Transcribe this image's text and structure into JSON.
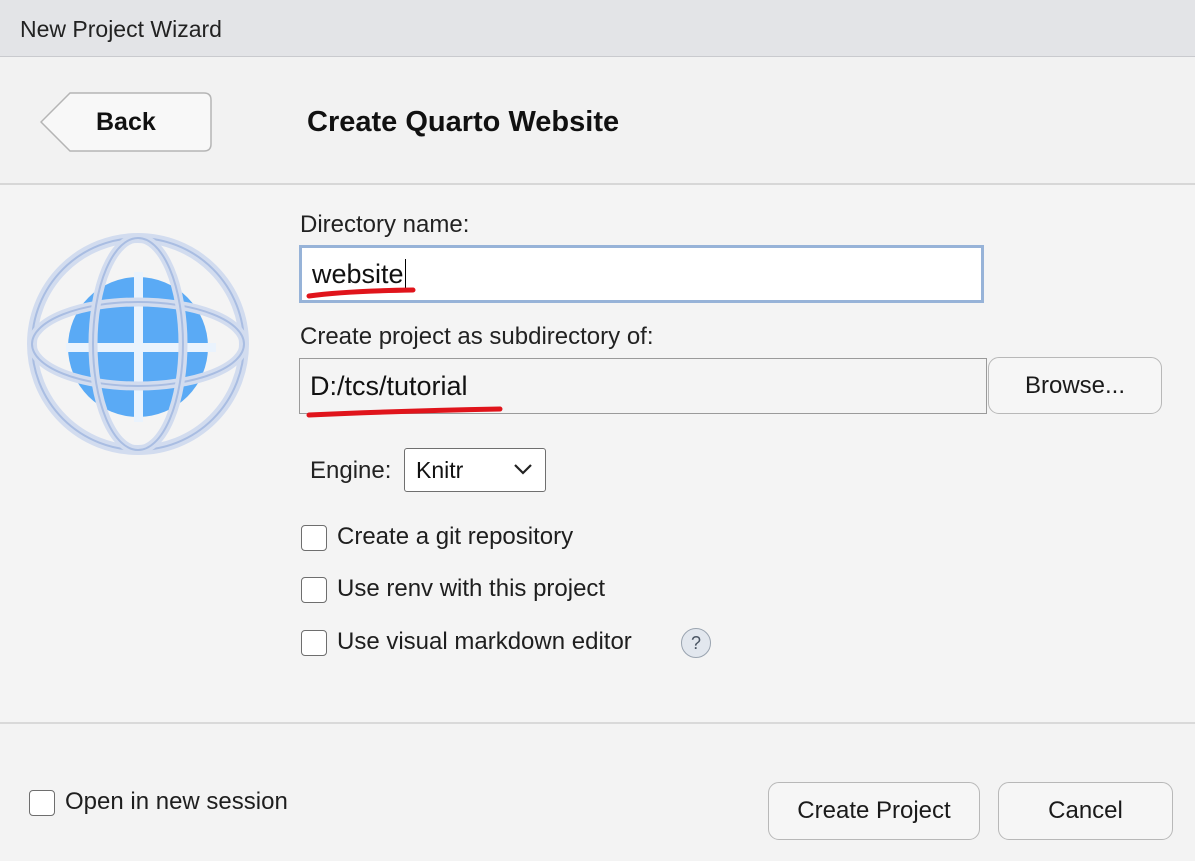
{
  "window": {
    "title": "New Project Wizard"
  },
  "header": {
    "back_label": "Back",
    "page_title": "Create Quarto Website"
  },
  "form": {
    "directory_name_label": "Directory name:",
    "directory_name_value": "website",
    "parent_dir_label": "Create project as subdirectory of:",
    "parent_dir_value": "D:/tcs/tutorial",
    "browse_label": "Browse...",
    "engine_label": "Engine:",
    "engine_value": "Knitr",
    "checkboxes": [
      {
        "label": "Create a git repository",
        "checked": false
      },
      {
        "label": "Use renv with this project",
        "checked": false
      },
      {
        "label": "Use visual markdown editor",
        "checked": false
      }
    ],
    "help_glyph": "?"
  },
  "footer": {
    "open_new_session_label": "Open in new session",
    "open_new_session_checked": false,
    "create_label": "Create Project",
    "cancel_label": "Cancel"
  },
  "colors": {
    "accent_focus_border": "#97b3d8",
    "annotation_red": "#e0141b",
    "logo_blue": "#5aaaf5"
  },
  "icons": {
    "logo": "quarto-globe-icon",
    "back": "back-arrow-button-shape",
    "dropdown": "chevron-down-icon",
    "help": "help-icon"
  }
}
